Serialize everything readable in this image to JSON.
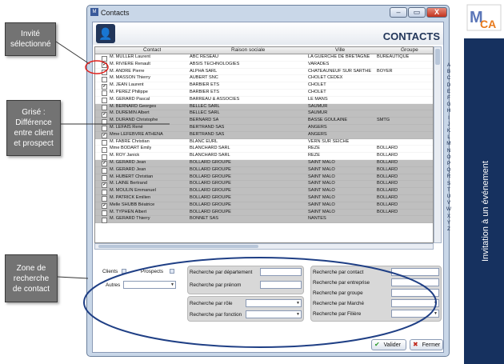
{
  "window": {
    "title": "Contacts",
    "min": "–",
    "max": "▭",
    "close": "X"
  },
  "header": {
    "title": "CONTACTS"
  },
  "grid": {
    "columns": [
      "Contact",
      "Raison sociale",
      "Ville",
      "Groupe"
    ],
    "rows": [
      {
        "checked": false,
        "contact": "M. MULLER Laurent",
        "raison": "ABC RÉSEAU",
        "ville": "LA GUERCHE DE BRETAGNE",
        "groupe": "BUREAUTIQUE",
        "grey": false
      },
      {
        "checked": true,
        "contact": "M. RIVIERE Renault",
        "raison": "ABSIS TECHNOLOGIES",
        "ville": "VARADES",
        "groupe": "",
        "grey": false
      },
      {
        "checked": false,
        "contact": "M. ANDRÉ Pierre",
        "raison": "ALPHA SARL",
        "ville": "CHATEAUNEUF SUR SARTHE",
        "groupe": "BOYER",
        "grey": false
      },
      {
        "checked": false,
        "contact": "M. MASSON Thierry",
        "raison": "AUBERT SNC",
        "ville": "CHOLET CEDEX",
        "groupe": "",
        "grey": false
      },
      {
        "checked": true,
        "contact": "M. JEAN Laurent",
        "raison": "BARBIER ETS",
        "ville": "CHOLET",
        "groupe": "",
        "grey": false
      },
      {
        "checked": false,
        "contact": "M. PEREZ Philippe",
        "raison": "BARBIER ETS",
        "ville": "CHOLET",
        "groupe": "",
        "grey": false
      },
      {
        "checked": false,
        "contact": "M. GERARD Pascal",
        "raison": "BARREAU & ASSOCIÉS",
        "ville": "LE MANS",
        "groupe": "",
        "grey": false
      },
      {
        "checked": false,
        "contact": "M. BERNARD Georges",
        "raison": "BELLEC SARL",
        "ville": "SAUMUR",
        "groupe": "",
        "grey": true
      },
      {
        "checked": true,
        "contact": "M. DUREMIN Albert",
        "raison": "BELLEC SARL",
        "ville": "SAUMUR",
        "groupe": "",
        "grey": true
      },
      {
        "checked": false,
        "contact": "M. DURAND Christophe",
        "raison": "BERNARD SA",
        "ville": "BASSE GOULAINE",
        "groupe": "SMTG",
        "grey": true
      },
      {
        "checked": false,
        "contact": "M. LEFAIS René",
        "raison": "BERTRAND SAS",
        "ville": "ANGERS",
        "groupe": "",
        "grey": true
      },
      {
        "checked": true,
        "contact": "Mme LEFEBVRE ATHENA",
        "raison": "BERTRAND SAS",
        "ville": "ANGERS",
        "groupe": "",
        "grey": true
      },
      {
        "checked": false,
        "contact": "M. FABRE Christian",
        "raison": "BLANC EURL",
        "ville": "VERN SUR SEICHE",
        "groupe": "",
        "grey": false
      },
      {
        "checked": false,
        "contact": "Mme BODART Emily",
        "raison": "BLANCHARD SARL",
        "ville": "REZE",
        "groupe": "BOLLARD",
        "grey": false
      },
      {
        "checked": false,
        "contact": "M. ROY Janick",
        "raison": "BLANCHARD SARL",
        "ville": "REZE",
        "groupe": "BOLLARD",
        "grey": false
      },
      {
        "checked": true,
        "contact": "M. GERARD Jean",
        "raison": "BOLLARD GROUPE",
        "ville": "SAINT MALO",
        "groupe": "BOLLARD",
        "grey": true
      },
      {
        "checked": false,
        "contact": "M. GERARD Jean",
        "raison": "BOLLARD GROUPE",
        "ville": "SAINT MALO",
        "groupe": "BOLLARD",
        "grey": true
      },
      {
        "checked": false,
        "contact": "M. HUBERT Christian",
        "raison": "BOLLARD GROUPE",
        "ville": "SAINT MALO",
        "groupe": "BOLLARD",
        "grey": true
      },
      {
        "checked": true,
        "contact": "M. LAINE Bertrand",
        "raison": "BOLLARD GROUPE",
        "ville": "SAINT MALO",
        "groupe": "BOLLARD",
        "grey": true
      },
      {
        "checked": false,
        "contact": "M. MOULIN Emmanuel",
        "raison": "BOLLARD GROUPE",
        "ville": "SAINT MALO",
        "groupe": "BOLLARD",
        "grey": true
      },
      {
        "checked": false,
        "contact": "M. PATRICK Emilien",
        "raison": "BOLLARD GROUPE",
        "ville": "SAINT MALO",
        "groupe": "BOLLARD",
        "grey": true
      },
      {
        "checked": true,
        "contact": "Melle SHUBB Béatrice",
        "raison": "BOLLARD GROUPE",
        "ville": "SAINT MALO",
        "groupe": "BOLLARD",
        "grey": true
      },
      {
        "checked": false,
        "contact": "M. TYPHEN Albert",
        "raison": "BOLLARD GROUPE",
        "ville": "SAINT MALO",
        "groupe": "BOLLARD",
        "grey": true
      },
      {
        "checked": false,
        "contact": "M. GERARD Thierry",
        "raison": "BONNET SAS",
        "ville": "NANTES",
        "groupe": "",
        "grey": true
      }
    ]
  },
  "alphabet": [
    "A",
    "B",
    "C",
    "D",
    "E",
    "F",
    "G",
    "H",
    "I",
    "J",
    "K",
    "L",
    "M",
    "N",
    "O",
    "P",
    "Q",
    "R",
    "S",
    "T",
    "U",
    "V",
    "W",
    "X",
    "Y",
    "Z"
  ],
  "filters": {
    "clients": "Clients",
    "prospects": "Prospects",
    "autres": "Autres",
    "dept": "Recherche par département",
    "prenom": "Recherche par prénom",
    "role": "Recherche par rôle",
    "fonction": "Recherche par fonction",
    "contact": "Recherche par contact",
    "entreprise": "Recherche par entreprise",
    "groupe": "Recherche par groupe",
    "marche": "Recherche par Marché",
    "filiere": "Recherche par Filière"
  },
  "buttons": {
    "valider": "Valider",
    "fermer": "Fermer"
  },
  "callouts": {
    "invite": "Invité sélectionné",
    "grise": "Grisé : Différence entre client et prospect",
    "zone": "Zone de recherche de contact"
  },
  "brand": {
    "logo": "MCA"
  },
  "sidebar": {
    "text": "Invitation à un événement"
  },
  "colors": {
    "accent": "#16315f",
    "highlight": "#e0201c",
    "grey_row": "#bfbfbf"
  }
}
